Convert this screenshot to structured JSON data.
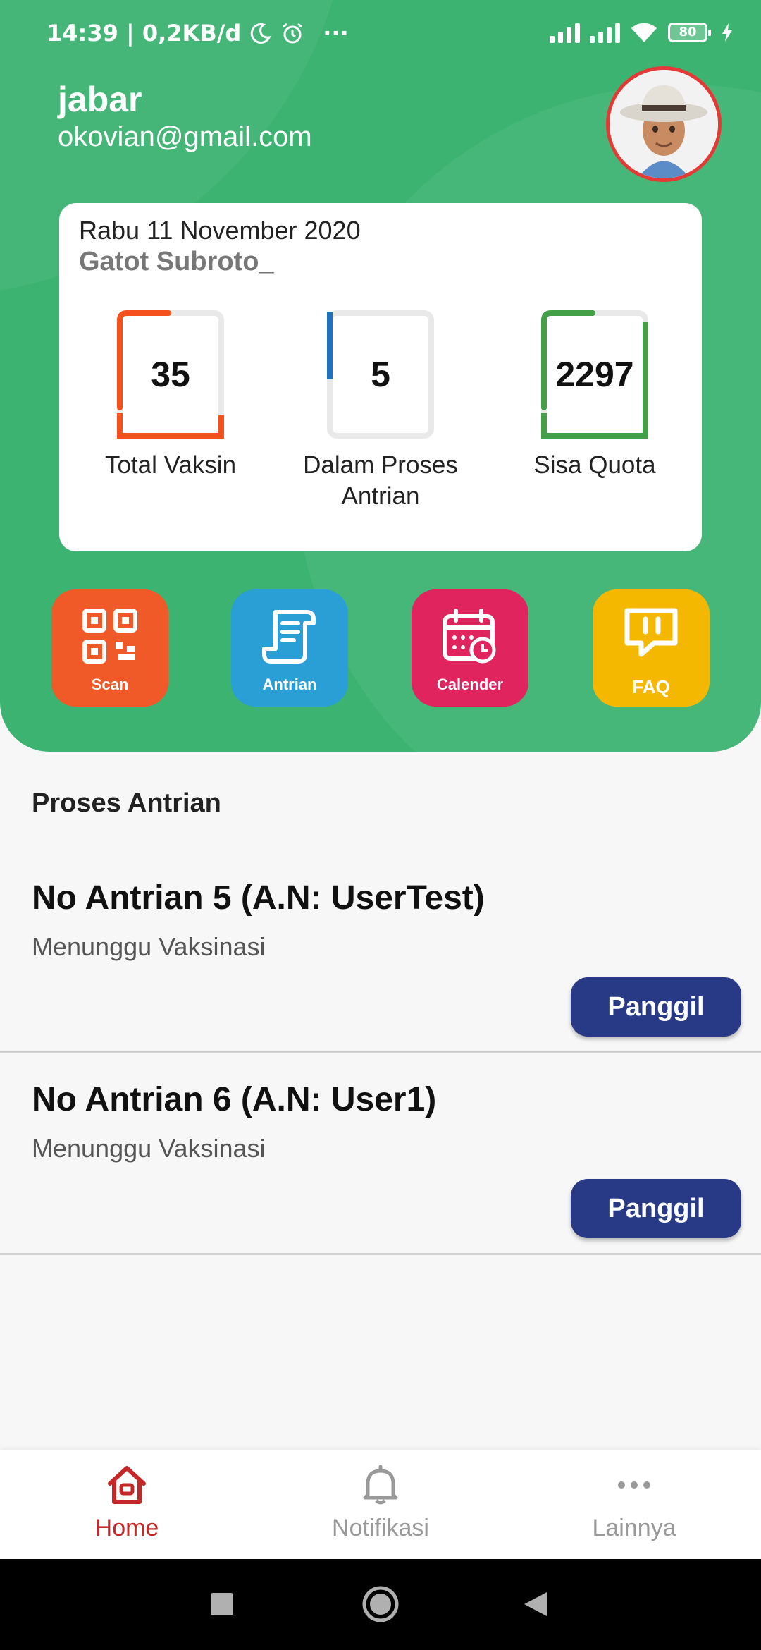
{
  "status_bar": {
    "time_speed": "14:39 | 0,2KB/d",
    "more": "···",
    "battery": "80"
  },
  "user": {
    "name": "jabar",
    "email": "okovian@gmail.com"
  },
  "summary": {
    "date": "Rabu 11 November 2020",
    "location": "Gatot Subroto_",
    "stats": [
      {
        "value": "35",
        "label": "Total Vaksin",
        "color": "#f4511e"
      },
      {
        "value": "5",
        "label": "Dalam Proses Antrian",
        "color": "#1e73be"
      },
      {
        "value": "2297",
        "label": "Sisa Quota",
        "color": "#43a047"
      }
    ]
  },
  "actions": [
    {
      "label": "Scan",
      "color": "#f05a28",
      "icon": "qr-code-icon"
    },
    {
      "label": "Antrian",
      "color": "#2a9fd6",
      "icon": "scroll-icon"
    },
    {
      "label": "Calender",
      "color": "#e0245e",
      "icon": "calendar-icon"
    },
    {
      "label": "FAQ",
      "color": "#f5b800",
      "icon": "chat-icon"
    }
  ],
  "queue": {
    "title": "Proses Antrian",
    "items": [
      {
        "title": "No Antrian 5 (A.N: UserTest)",
        "status": "Menunggu Vaksinasi",
        "button": "Panggil"
      },
      {
        "title": "No Antrian 6 (A.N: User1)",
        "status": "Menunggu Vaksinasi",
        "button": "Panggil"
      }
    ]
  },
  "nav": {
    "items": [
      {
        "label": "Home",
        "active": true
      },
      {
        "label": "Notifikasi",
        "active": false
      },
      {
        "label": "Lainnya",
        "active": false
      }
    ],
    "active_color": "#c62828"
  }
}
